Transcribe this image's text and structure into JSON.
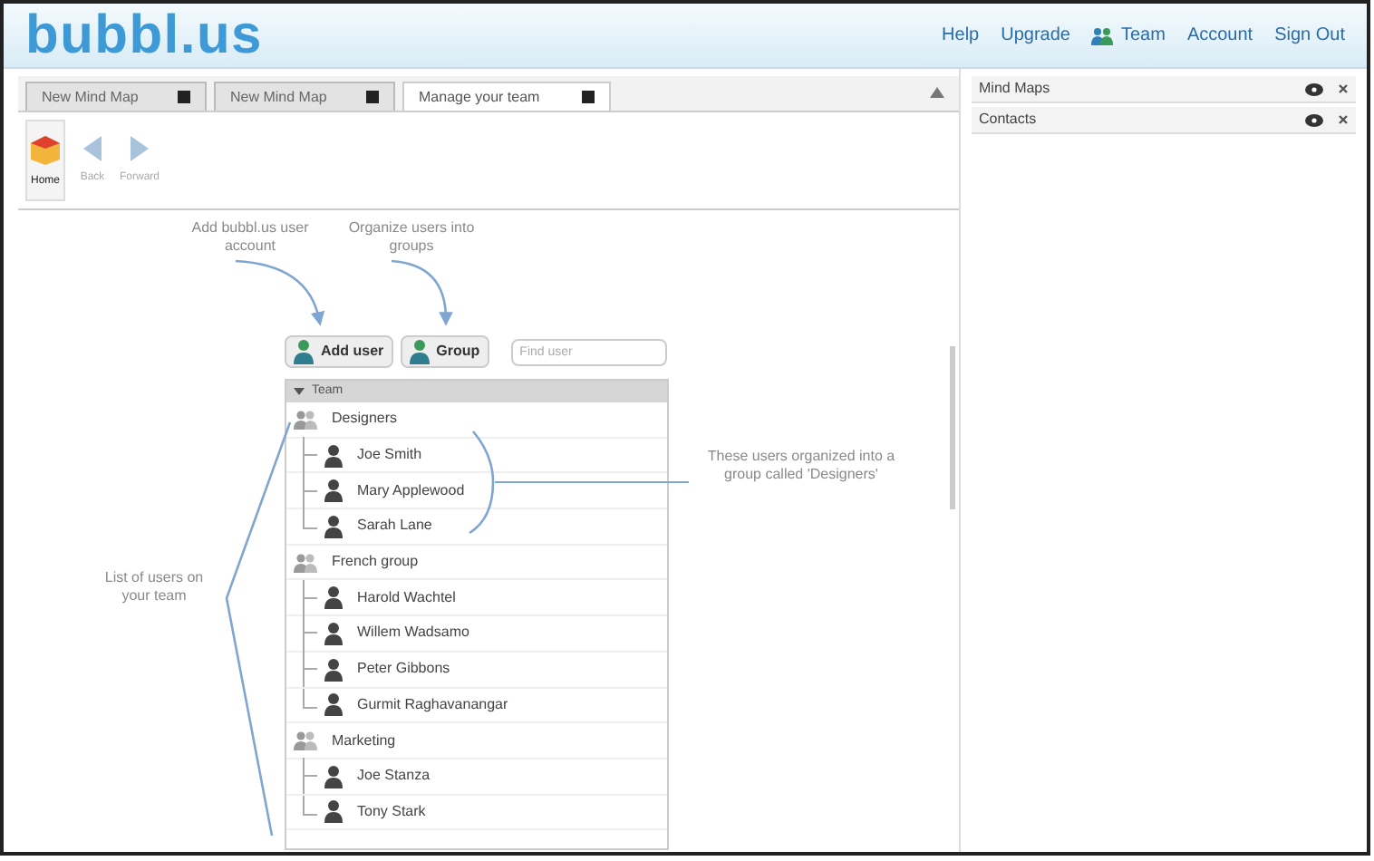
{
  "header": {
    "logo": "bubbl.us",
    "links": [
      {
        "label": "Help",
        "kind": "text"
      },
      {
        "label": "Upgrade",
        "kind": "text"
      },
      {
        "label": "Team",
        "kind": "team"
      },
      {
        "label": "Account",
        "kind": "text"
      },
      {
        "label": "Sign Out",
        "kind": "text"
      }
    ]
  },
  "tabs": [
    {
      "label": "New Mind Map",
      "selected": false
    },
    {
      "label": "New Mind Map",
      "selected": false
    },
    {
      "label": "Manage your team",
      "selected": true
    }
  ],
  "toolbar": [
    {
      "label": "Home",
      "kind": "home",
      "disabled": false
    },
    {
      "label": "Back",
      "kind": "back",
      "disabled": true
    },
    {
      "label": "Forward",
      "kind": "forward",
      "disabled": true
    }
  ],
  "side_panels": [
    {
      "label": "Mind Maps"
    },
    {
      "label": "Contacts"
    }
  ],
  "annotations": {
    "add_user": "Add bubbl.us user account",
    "group": "Organize users into groups",
    "designers": "These users organized into a group called 'Designers'",
    "team": "List of users on your team"
  },
  "team_toolbar": {
    "add_user": "Add user",
    "group": "Group",
    "search": {
      "placeholder": "Find user"
    }
  },
  "tree": {
    "title": "Team",
    "expanded": true,
    "groups": [
      {
        "name": "Designers",
        "children": [
          {
            "name": "Joe Smith"
          },
          {
            "name": "Mary Applewood"
          },
          {
            "name": "Sarah Lane"
          }
        ]
      },
      {
        "name": "French group",
        "children": [
          {
            "name": "Harold Wachtel"
          },
          {
            "name": "Willem Wadsamo"
          },
          {
            "name": "Peter Gibbons"
          },
          {
            "name": "Gurmit Raghavanangar"
          }
        ]
      },
      {
        "name": "Marketing",
        "children": [
          {
            "name": "Joe Stanza"
          },
          {
            "name": "Tony Stark"
          }
        ]
      }
    ]
  }
}
